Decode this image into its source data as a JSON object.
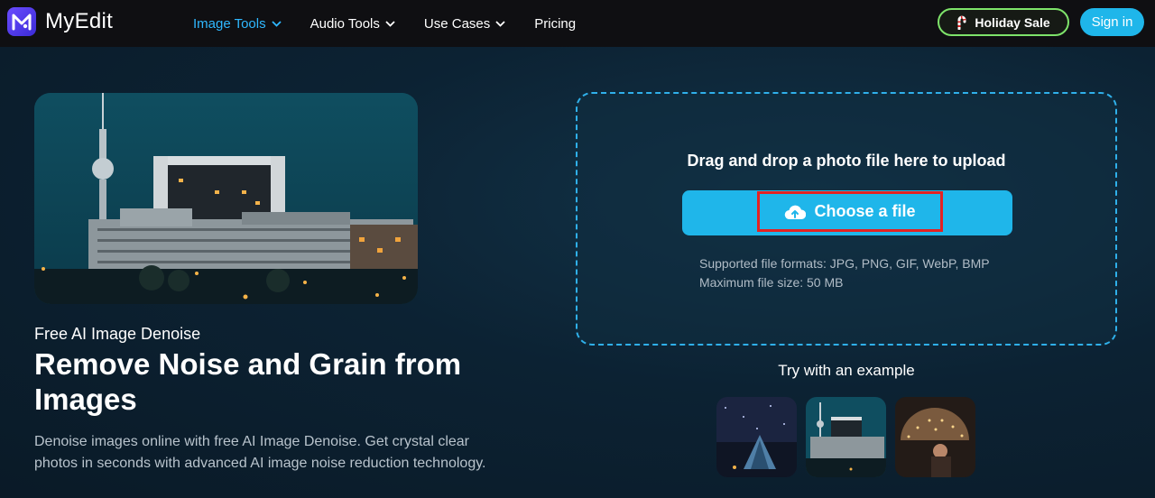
{
  "brand": {
    "name": "MyEdit",
    "logo_letter": "M",
    "accent": "#1fb6ea",
    "nav_active_color": "#2fb8ff"
  },
  "nav": {
    "items": [
      {
        "label": "Image Tools",
        "active": true,
        "has_dropdown": true
      },
      {
        "label": "Audio Tools",
        "active": false,
        "has_dropdown": true
      },
      {
        "label": "Use Cases",
        "active": false,
        "has_dropdown": true
      },
      {
        "label": "Pricing",
        "active": false,
        "has_dropdown": false
      }
    ],
    "holiday_label": "Holiday Sale",
    "holiday_icon": "candy-cane-icon",
    "signin_label": "Sign in"
  },
  "hero": {
    "subtitle": "Free AI Image Denoise",
    "title": "Remove Noise and Grain from Images",
    "description": "Denoise images online with free AI Image Denoise. Get crystal clear photos in seconds with advanced AI image noise reduction technology."
  },
  "upload": {
    "heading": "Drag and drop a photo file here to upload",
    "button_label": "Choose a file",
    "button_icon": "cloud-upload-icon",
    "formats_line": "Supported file formats: JPG, PNG, GIF, WebP, BMP",
    "max_size_line": "Maximum file size: 50 MB"
  },
  "examples": {
    "label": "Try with an example",
    "items": [
      {
        "name": "night-sky-tent"
      },
      {
        "name": "city-tower-night"
      },
      {
        "name": "umbrella-lights"
      }
    ]
  }
}
